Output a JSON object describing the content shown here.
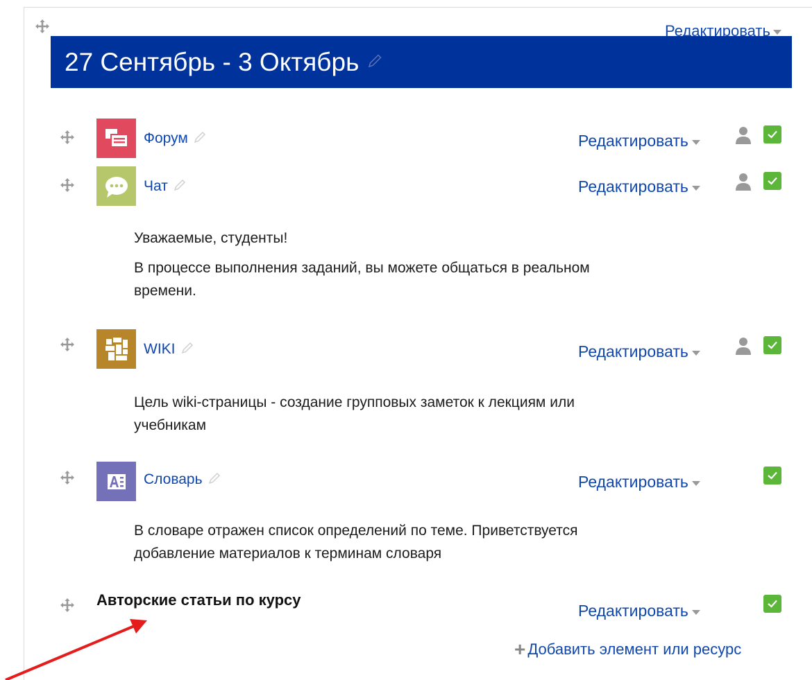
{
  "section": {
    "title": "27 Сентябрь - 3 Октябрь",
    "edit_label": "Редактировать"
  },
  "activities": [
    {
      "name": "Форум",
      "edit_label": "Редактировать",
      "icon": "forum-icon",
      "icon_color": "#e0495e"
    },
    {
      "name": "Чат",
      "edit_label": "Редактировать",
      "icon": "chat-icon",
      "icon_color": "#b5c66b"
    },
    {
      "name": "WIKI",
      "edit_label": "Редактировать",
      "icon": "wiki-icon",
      "icon_color": "#b8862a"
    },
    {
      "name": "Словарь",
      "edit_label": "Редактировать",
      "icon": "glossary-icon",
      "icon_color": "#7471b8"
    }
  ],
  "descriptions": {
    "chat_line1": "Уважаемые, студенты!",
    "chat_line2": "В процессе выполнения заданий, вы можете общаться в реальном",
    "chat_line3": "времени.",
    "wiki_line1": "Цель wiki-страницы - создание групповых заметок к лекциям или",
    "wiki_line2": "учебникам",
    "glossary_line1": "В словаре отражен список определений по теме. Приветствуется",
    "glossary_line2": "добавление материалов к терминам словаря"
  },
  "label": {
    "text": "Авторские статьи по курсу",
    "edit_label": "Редактировать"
  },
  "add_resource_label": "Добавить элемент или ресурс",
  "colors": {
    "section_header_bg": "#00329b",
    "link": "#0f47ad",
    "check_green": "#5cb63a",
    "annotation_arrow": "#e51c1c"
  }
}
